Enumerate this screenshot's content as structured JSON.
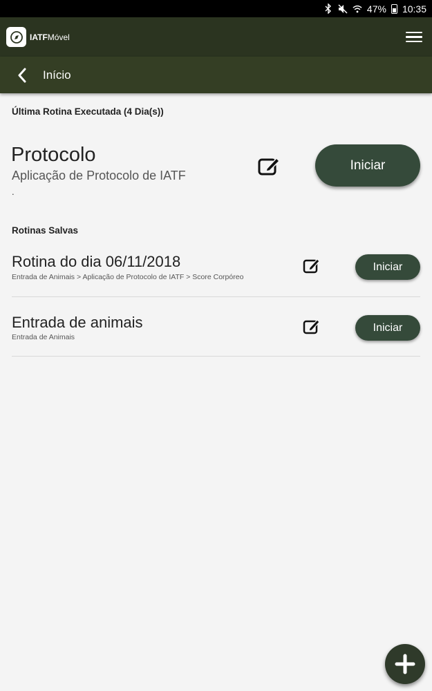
{
  "status_bar": {
    "icons": [
      "bluetooth-icon",
      "mute-icon",
      "wifi-icon",
      "battery-icon"
    ],
    "battery": "47%",
    "time": "10:35"
  },
  "app_bar": {
    "logo_bold": "IATF",
    "logo_light": "Móvel",
    "menu_icon": "hamburger-menu-icon"
  },
  "sub_bar": {
    "back_icon": "chevron-left-icon",
    "title": "Início"
  },
  "last_routine": {
    "section_label": "Última Rotina Executada (4 Dia(s))",
    "title": "Protocolo",
    "subtitle": "Aplicação de Protocolo de IATF",
    "extra": ".",
    "edit_icon": "edit-icon",
    "start_label": "Iniciar"
  },
  "saved_routines": {
    "section_label": "Rotinas Salvas",
    "items": [
      {
        "title": "Rotina do dia 06/11/2018",
        "path": "Entrada de Animais > Aplicação de Protocolo de IATF > Score Corpóreo",
        "start_label": "Iniciar"
      },
      {
        "title": "Entrada de animais",
        "path": "Entrada de Animais",
        "start_label": "Iniciar"
      }
    ]
  },
  "fab": {
    "icon": "plus-icon"
  },
  "colors": {
    "app_bar": "#2b3420",
    "sub_bar": "#343e24",
    "button": "#354a3a",
    "background": "#f4f4f4"
  }
}
